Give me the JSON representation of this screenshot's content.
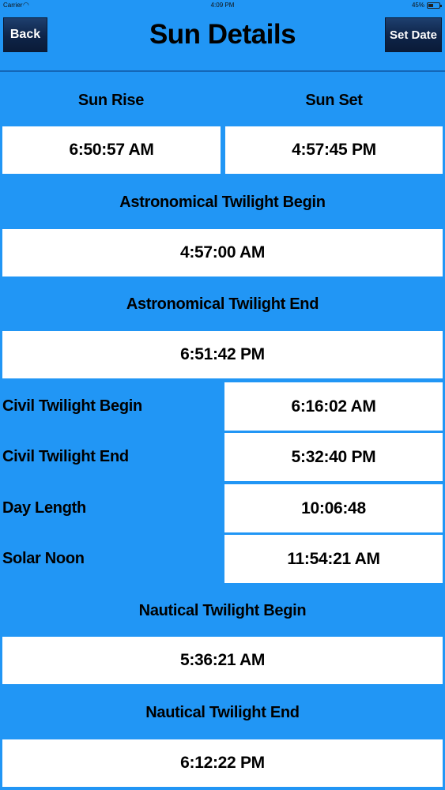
{
  "status_bar": {
    "carrier": "Carrier",
    "time": "4:09 PM",
    "battery": "45%"
  },
  "header": {
    "back_label": "Back",
    "title": "Sun Details",
    "set_date_label": "Set Date"
  },
  "sun_rise": {
    "label": "Sun Rise",
    "value": "6:50:57 AM"
  },
  "sun_set": {
    "label": "Sun Set",
    "value": "4:57:45 PM"
  },
  "astronomical_twilight_begin": {
    "label": "Astronomical Twilight Begin",
    "value": "4:57:00 AM"
  },
  "astronomical_twilight_end": {
    "label": "Astronomical Twilight End",
    "value": "6:51:42 PM"
  },
  "civil_twilight_begin": {
    "label": "Civil Twilight Begin",
    "value": "6:16:02 AM"
  },
  "civil_twilight_end": {
    "label": "Civil Twilight End",
    "value": "5:32:40 PM"
  },
  "day_length": {
    "label": "Day Length",
    "value": "10:06:48"
  },
  "solar_noon": {
    "label": "Solar Noon",
    "value": "11:54:21 AM"
  },
  "nautical_twilight_begin": {
    "label": "Nautical Twilight Begin",
    "value": "5:36:21 AM"
  },
  "nautical_twilight_end": {
    "label": "Nautical Twilight End",
    "value": "6:12:22 PM"
  }
}
